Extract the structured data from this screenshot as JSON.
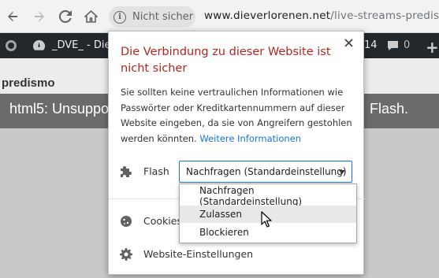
{
  "toolbar": {
    "back_icon": "arrow-left-icon",
    "forward_icon": "arrow-right-icon",
    "reload_icon": "reload-icon",
    "home_icon": "home-icon",
    "security_label": "Nicht sicher",
    "url_domain": "www.dieverlorenen.net",
    "url_path": "/live-streams-predismo/"
  },
  "adminbar": {
    "site_name": "_DVE_ - Die V",
    "comments_count": "0",
    "updates_count": "14"
  },
  "page": {
    "breadcrumb": "predismo",
    "player_message_start": "html5: Unsuppo",
    "player_message_end": "Flash."
  },
  "popup": {
    "title": "Die Verbindung zu dieser Website ist nicht sicher",
    "body": "Sie sollten keine vertraulichen Informationen wie Passwörter oder Kreditkartennummern auf dieser Website eingeben, da sie von Angreifern gestohlen werden könnten.",
    "more_info_link": "Weitere Informationen",
    "flash_label": "Flash",
    "flash_selected": "Nachfragen (Standardeinstellung)",
    "cookies_label": "Cookies",
    "site_settings_label": "Website-Einstellungen",
    "dropdown_options": [
      "Nachfragen (Standardeinstellung)",
      "Zulassen",
      "Blockieren"
    ]
  },
  "colors": {
    "title_red": "#b3261e",
    "link_blue": "#1a73e8",
    "adminbar_bg": "#23282d"
  }
}
